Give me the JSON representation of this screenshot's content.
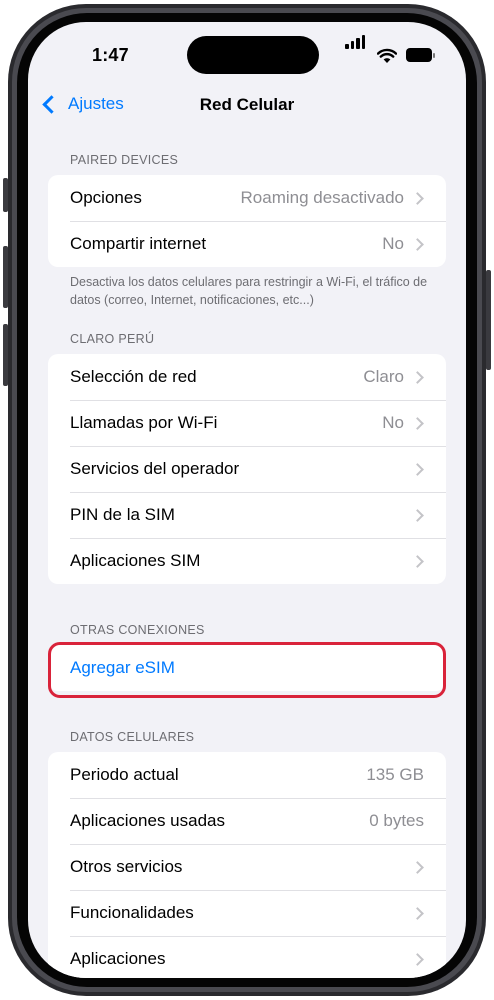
{
  "status": {
    "time": "1:47"
  },
  "nav": {
    "back_label": "Ajustes",
    "title": "Red Celular"
  },
  "paired": {
    "header": "PAIRED DEVICES",
    "rows": [
      {
        "label": "Opciones",
        "value": "Roaming desactivado"
      },
      {
        "label": "Compartir internet",
        "value": "No"
      }
    ],
    "footer": "Desactiva los datos celulares para restringir a Wi-Fi, el tráfico de datos (correo, Internet, notificaciones, etc...)"
  },
  "claro": {
    "header": "CLARO PERÚ",
    "rows": [
      {
        "label": "Selección de red",
        "value": "Claro"
      },
      {
        "label": "Llamadas por Wi-Fi",
        "value": "No"
      },
      {
        "label": "Servicios del operador",
        "value": ""
      },
      {
        "label": "PIN de la SIM",
        "value": ""
      },
      {
        "label": "Aplicaciones SIM",
        "value": ""
      }
    ]
  },
  "otras": {
    "header": "OTRAS CONEXIONES",
    "add_esim": "Agregar eSIM"
  },
  "datos": {
    "header": "DATOS CELULARES",
    "rows": [
      {
        "label": "Periodo actual",
        "value": "135 GB"
      },
      {
        "label": "Aplicaciones usadas",
        "value": "0 bytes"
      },
      {
        "label": "Otros servicios",
        "value": ""
      },
      {
        "label": "Funcionalidades",
        "value": ""
      },
      {
        "label": "Aplicaciones",
        "value": ""
      }
    ]
  },
  "colors": {
    "accent": "#007aff",
    "highlight": "#d9233a",
    "background": "#f2f2f7"
  }
}
